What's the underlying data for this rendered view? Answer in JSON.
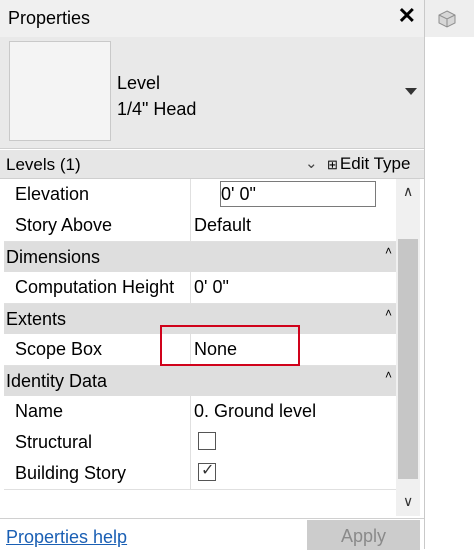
{
  "panel": {
    "title": "Properties",
    "close_glyph": "✕"
  },
  "type_selector": {
    "family": "Level",
    "type": "1/4\" Head"
  },
  "filter": {
    "label": "Levels (1)",
    "chevron": "⌄",
    "edit_type_label": "Edit Type",
    "edit_type_icon": "⊞"
  },
  "rows": {
    "elevation": {
      "label": "Elevation",
      "value": "0'  0\""
    },
    "story_above": {
      "label": "Story Above",
      "value": "Default"
    },
    "group_dimensions": {
      "label": "Dimensions"
    },
    "computation_height": {
      "label": "Computation Height",
      "value": "0'  0\""
    },
    "group_extents": {
      "label": "Extents"
    },
    "scope_box": {
      "label": "Scope Box",
      "value": "None"
    },
    "group_identity": {
      "label": "Identity Data"
    },
    "name": {
      "label": "Name",
      "value": "0. Ground level"
    },
    "structural": {
      "label": "Structural",
      "checked": false
    },
    "building_story": {
      "label": "Building Story",
      "checked": true
    }
  },
  "group_collapse_glyph": "˄",
  "footer": {
    "help_link": "Properties help",
    "apply_label": "Apply"
  },
  "icons": {
    "close": "close-icon",
    "dropdown": "chevron-down-icon",
    "edit_type": "edit-type-icon",
    "view_cube": "view-cube-icon",
    "check": "✓"
  },
  "colors": {
    "highlight_border": "#d0021b",
    "link": "#1a5fb4",
    "apply_disabled_bg": "#cccccc"
  }
}
